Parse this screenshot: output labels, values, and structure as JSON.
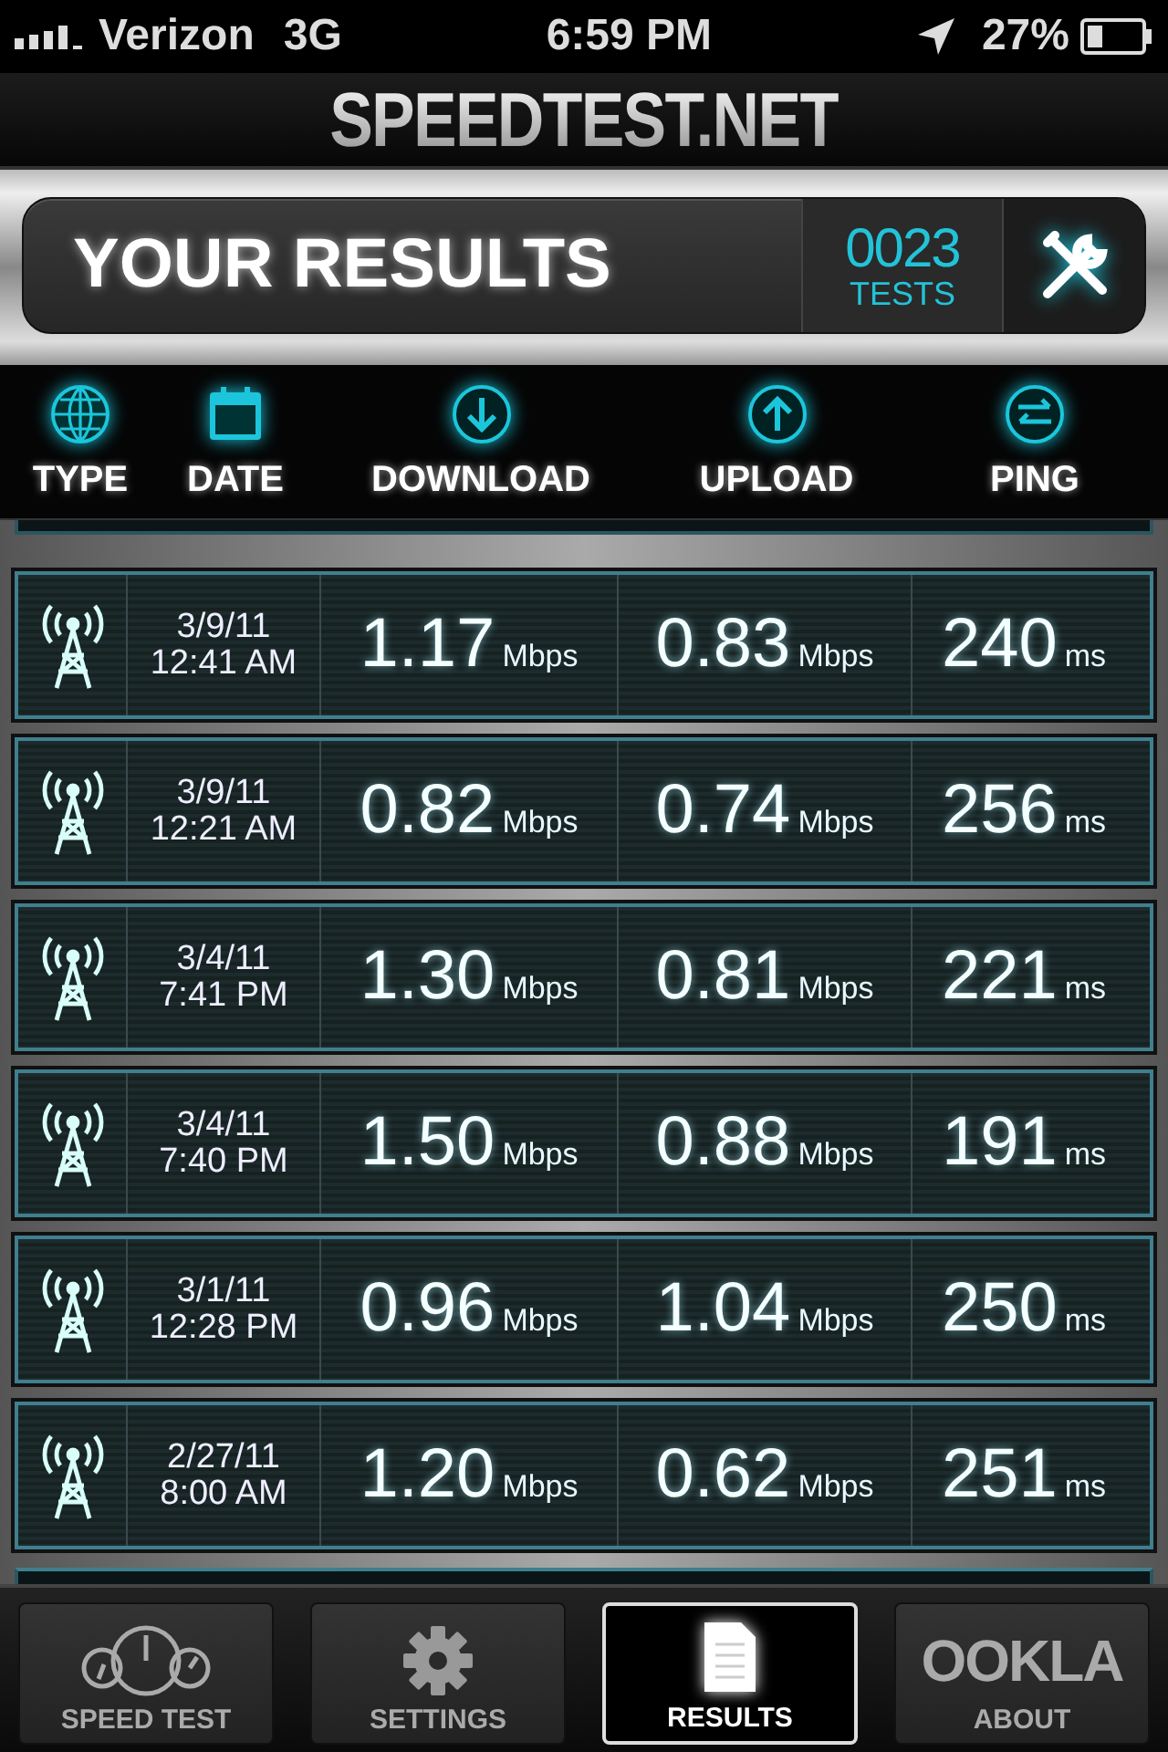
{
  "status_bar": {
    "carrier": "Verizon",
    "network": "3G",
    "time": "6:59 PM",
    "battery": "27%"
  },
  "app_title": "SPEEDTEST.NET",
  "results_panel": {
    "title": "YOUR RESULTS",
    "count": "0023",
    "count_label": "TESTS"
  },
  "columns": [
    "TYPE",
    "DATE",
    "DOWNLOAD",
    "UPLOAD",
    "PING"
  ],
  "rows": [
    {
      "date": "3/9/11",
      "time": "12:41 AM",
      "download": {
        "value": "1.17",
        "unit": "Mbps"
      },
      "upload": {
        "value": "0.83",
        "unit": "Mbps"
      },
      "ping": {
        "value": "240",
        "unit": "ms"
      }
    },
    {
      "date": "3/9/11",
      "time": "12:21 AM",
      "download": {
        "value": "0.82",
        "unit": "Mbps"
      },
      "upload": {
        "value": "0.74",
        "unit": "Mbps"
      },
      "ping": {
        "value": "256",
        "unit": "ms"
      }
    },
    {
      "date": "3/4/11",
      "time": "7:41 PM",
      "download": {
        "value": "1.30",
        "unit": "Mbps"
      },
      "upload": {
        "value": "0.81",
        "unit": "Mbps"
      },
      "ping": {
        "value": "221",
        "unit": "ms"
      }
    },
    {
      "date": "3/4/11",
      "time": "7:40 PM",
      "download": {
        "value": "1.50",
        "unit": "Mbps"
      },
      "upload": {
        "value": "0.88",
        "unit": "Mbps"
      },
      "ping": {
        "value": "191",
        "unit": "ms"
      }
    },
    {
      "date": "3/1/11",
      "time": "12:28 PM",
      "download": {
        "value": "0.96",
        "unit": "Mbps"
      },
      "upload": {
        "value": "1.04",
        "unit": "Mbps"
      },
      "ping": {
        "value": "250",
        "unit": "ms"
      }
    },
    {
      "date": "2/27/11",
      "time": "8:00 AM",
      "download": {
        "value": "1.20",
        "unit": "Mbps"
      },
      "upload": {
        "value": "0.62",
        "unit": "Mbps"
      },
      "ping": {
        "value": "251",
        "unit": "ms"
      }
    }
  ],
  "tab_bar": [
    {
      "kind": "speedometer",
      "label": "SPEED TEST",
      "selected": false
    },
    {
      "kind": "gear",
      "label": "SETTINGS",
      "selected": false
    },
    {
      "kind": "document",
      "label": "RESULTS",
      "selected": true
    },
    {
      "kind": "logo",
      "logo": "OOKLA",
      "label": "ABOUT",
      "selected": false
    }
  ]
}
